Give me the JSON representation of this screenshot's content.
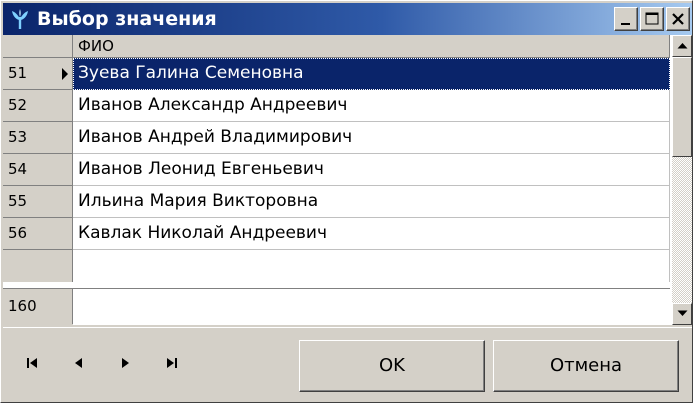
{
  "window": {
    "title": "Выбор значения",
    "app_icon": "plant-sprout-icon",
    "title_gradient": [
      "#0a246a",
      "#a6caf0"
    ]
  },
  "grid": {
    "column_header": "ФИО",
    "rows": [
      {
        "num": "51",
        "name": "Зуева Галина Семеновна",
        "selected": true
      },
      {
        "num": "52",
        "name": "Иванов Александр Андреевич",
        "selected": false
      },
      {
        "num": "53",
        "name": "Иванов Андрей Владимирович",
        "selected": false
      },
      {
        "num": "54",
        "name": "Иванов Леонид Евгеньевич",
        "selected": false
      },
      {
        "num": "55",
        "name": "Ильина Мария Викторовна",
        "selected": false
      },
      {
        "num": "56",
        "name": "Кавлак Николай Андреевич",
        "selected": false
      }
    ],
    "footer_count": "160",
    "selection_color": "#0a246a"
  },
  "buttons": {
    "ok": "OK",
    "cancel": "Отмена"
  }
}
